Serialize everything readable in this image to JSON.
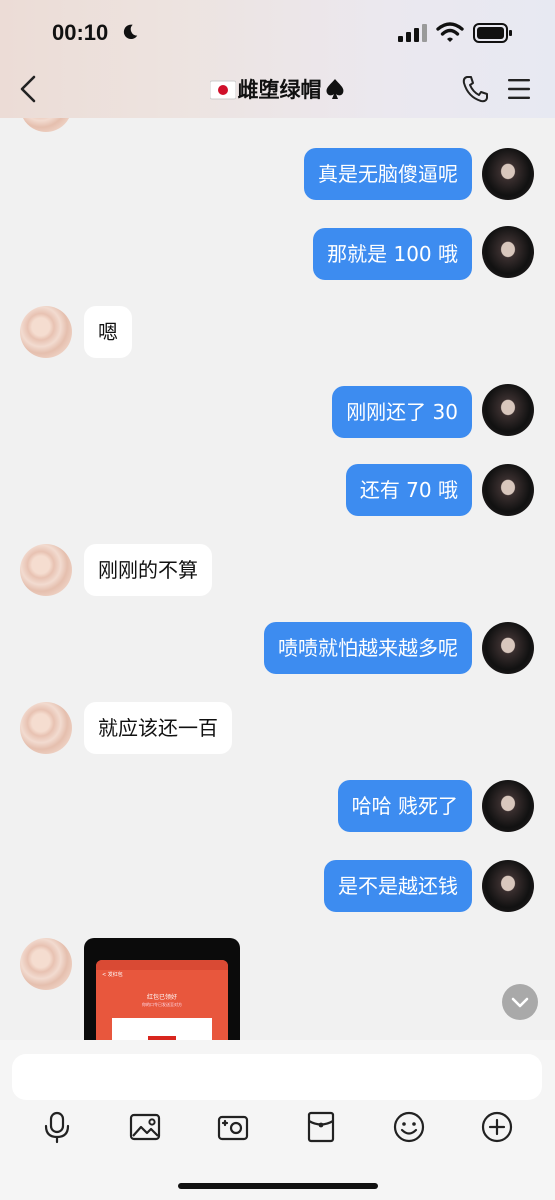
{
  "status_bar": {
    "time": "00:10"
  },
  "header": {
    "title": "雌堕绿帽"
  },
  "messages": [
    {
      "side": "out",
      "text": "真是无脑傻逼呢"
    },
    {
      "side": "out",
      "text": "那就是 100 哦"
    },
    {
      "side": "in",
      "text": "嗯"
    },
    {
      "side": "out",
      "text": "刚刚还了 30"
    },
    {
      "side": "out",
      "text": "还有 70 哦"
    },
    {
      "side": "in",
      "text": "刚刚的不算"
    },
    {
      "side": "out",
      "text": "啧啧就怕越来越多呢"
    },
    {
      "side": "in",
      "text": "就应该还一百"
    },
    {
      "side": "out",
      "text": "哈哈 贱死了"
    },
    {
      "side": "out",
      "text": "是不是越还钱"
    }
  ],
  "image_message": {
    "app_header": "< 发红包",
    "line1": "红包已领好",
    "line2": "你的口令已发送至对方"
  },
  "composer": {
    "placeholder": ""
  },
  "toolbar": {
    "icons": [
      "microphone-icon",
      "image-icon",
      "camera-icon",
      "red-packet-icon",
      "emoji-icon",
      "plus-icon"
    ]
  },
  "colors": {
    "outgoing_bubble": "#3d8cf0",
    "incoming_bubble": "#ffffff",
    "background": "#f1f1f1"
  }
}
